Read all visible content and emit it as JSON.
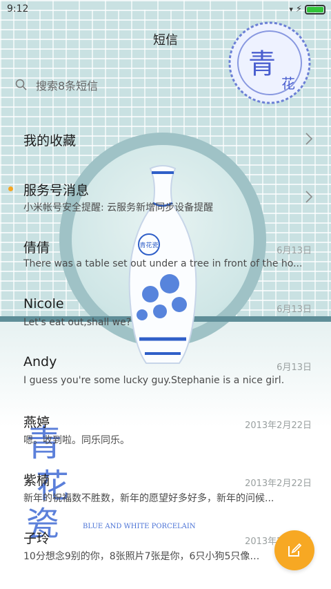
{
  "statusbar": {
    "time": "9:12",
    "battery_level": 1.0
  },
  "header": {
    "title": "短信"
  },
  "search": {
    "placeholder": "搜索8条短信"
  },
  "favorites": {
    "label": "我的收藏"
  },
  "service": {
    "label": "服务号消息",
    "snippet": "小米帐号安全提醒: 云服务新增同步设备提醒",
    "unread": true
  },
  "conversations": [
    {
      "name": "倩倩",
      "date": "6月13日",
      "snippet": "There was a table set out under a tree in front of the ho..."
    },
    {
      "name": "Nicole",
      "date": "6月13日",
      "snippet": "Let's eat out,shall we?"
    },
    {
      "name": "Andy",
      "date": "6月13日",
      "snippet": "I guess you're some lucky guy.Stephanie is a nice girl."
    },
    {
      "name": "燕婷",
      "date": "2013年2月22日",
      "snippet": "嗯。收到啦。同乐同乐。"
    },
    {
      "name": "紫楠",
      "date": "2013年2月22日",
      "snippet": "新年的祝福数不胜数，新年的愿望好多好多，新年的问候..."
    },
    {
      "name": "子玲",
      "date": "2013年2月22日",
      "snippet": "10分想念9别的你，8张照片7张是你，6只小狗5只像你..."
    }
  ],
  "decor": {
    "stamp_text": "青花瓷",
    "banner_text": "青花瓷",
    "banner_subtitle": "BLUE AND WHITE PORCELAIN",
    "vase_label": "青花瓷"
  },
  "colors": {
    "accent": "#f7a823",
    "porcelain_blue": "#2f5fc8",
    "battery": "#32c43a"
  },
  "icons": {
    "search": "search-icon",
    "compose": "compose-icon",
    "chevron": "chevron-right-icon"
  }
}
